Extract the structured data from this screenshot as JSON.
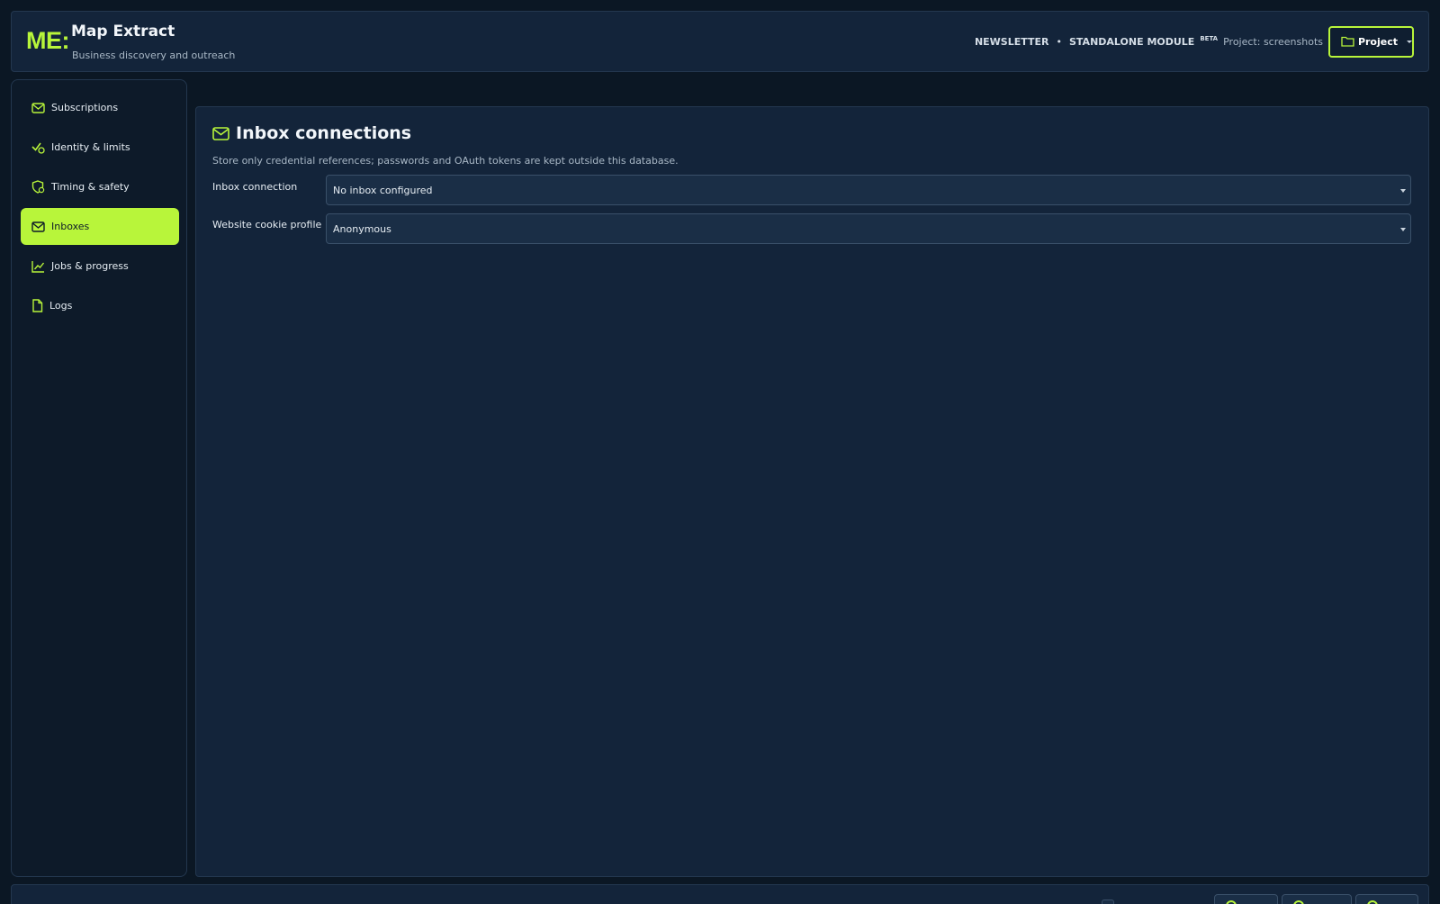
{
  "app": {
    "logo": "ME:",
    "title": "Map Extract",
    "subtitle": "Business discovery and outreach"
  },
  "header": {
    "newsletter_label": "NEWSLETTER",
    "separator": "•",
    "module_label": "STANDALONE MODULE",
    "beta_label": "BETA",
    "project_status": "Project: screenshots",
    "project_button": "Project"
  },
  "sidebar": {
    "items": [
      {
        "label": "Subscriptions",
        "icon": "mail-icon"
      },
      {
        "label": "Identity & limits",
        "icon": "check-badge-icon"
      },
      {
        "label": "Timing & safety",
        "icon": "shield-clock-icon"
      },
      {
        "label": "Inboxes",
        "icon": "mail-icon",
        "active": true
      },
      {
        "label": "Jobs & progress",
        "icon": "line-chart-icon"
      },
      {
        "label": "Logs",
        "icon": "file-icon"
      }
    ]
  },
  "main": {
    "title": "Inbox connections",
    "description": "Store only credential references; passwords and OAuth tokens are kept outside this database.",
    "fields": [
      {
        "label": "Inbox connection",
        "value": "No inbox configured"
      },
      {
        "label": "Website cookie profile",
        "value": "Anonymous"
      }
    ]
  },
  "colors": {
    "accent": "#b8f53a",
    "background": "#0b1724",
    "panel": "#13243a"
  }
}
